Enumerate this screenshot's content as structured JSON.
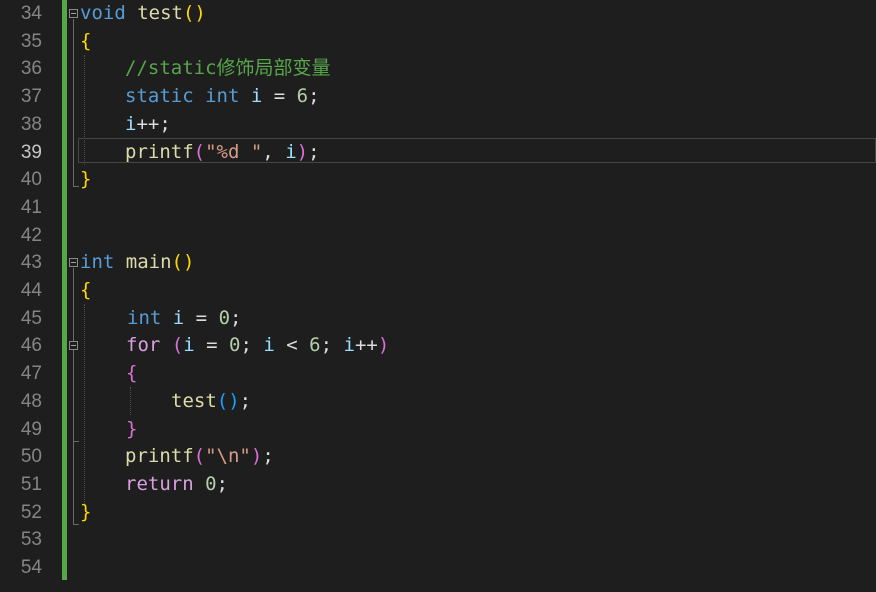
{
  "editor": {
    "current_line": "39",
    "line_numbers": [
      "34",
      "35",
      "36",
      "37",
      "38",
      "39",
      "40",
      "41",
      "42",
      "43",
      "44",
      "45",
      "46",
      "47",
      "48",
      "49",
      "50",
      "51",
      "52",
      "53",
      "54"
    ]
  },
  "code": {
    "l34": {
      "kw": "void",
      "fn": "test",
      "parens": "()"
    },
    "l35": {
      "brace": "{"
    },
    "l36": {
      "comment": "//static修饰局部变量"
    },
    "l37": {
      "kw1": "static",
      "kw2": "int",
      "var": "i",
      "op": " = ",
      "num": "6",
      "semi": ";"
    },
    "l38": {
      "var": "i",
      "rest": "++;"
    },
    "l39": {
      "fn": "printf",
      "open": "(",
      "str": "\"%d \"",
      "comma": ", ",
      "var": "i",
      "close": ")",
      "semi": ";"
    },
    "l40": {
      "brace": "}"
    },
    "l43": {
      "kw": "int",
      "fn": "main",
      "parens": "()"
    },
    "l44": {
      "brace": "{"
    },
    "l45": {
      "kw": "int",
      "var": "i",
      "op": " = ",
      "num": "0",
      "semi": ";"
    },
    "l46": {
      "kw": "for",
      "open": "(",
      "var1": "i",
      "op1": " = ",
      "num1": "0",
      "semi1": "; ",
      "var2": "i",
      "op2": " < ",
      "num2": "6",
      "semi2": "; ",
      "var3": "i",
      "inc": "++",
      "close": ")"
    },
    "l47": {
      "brace": "{"
    },
    "l48": {
      "fn": "test",
      "parens": "()",
      "semi": ";"
    },
    "l49": {
      "brace": "}"
    },
    "l50": {
      "fn": "printf",
      "open": "(",
      "str": "\"\\n\"",
      "close": ")",
      "semi": ";"
    },
    "l51": {
      "kw": "return",
      "num": "0",
      "semi": ";"
    },
    "l52": {
      "brace": "}"
    }
  }
}
